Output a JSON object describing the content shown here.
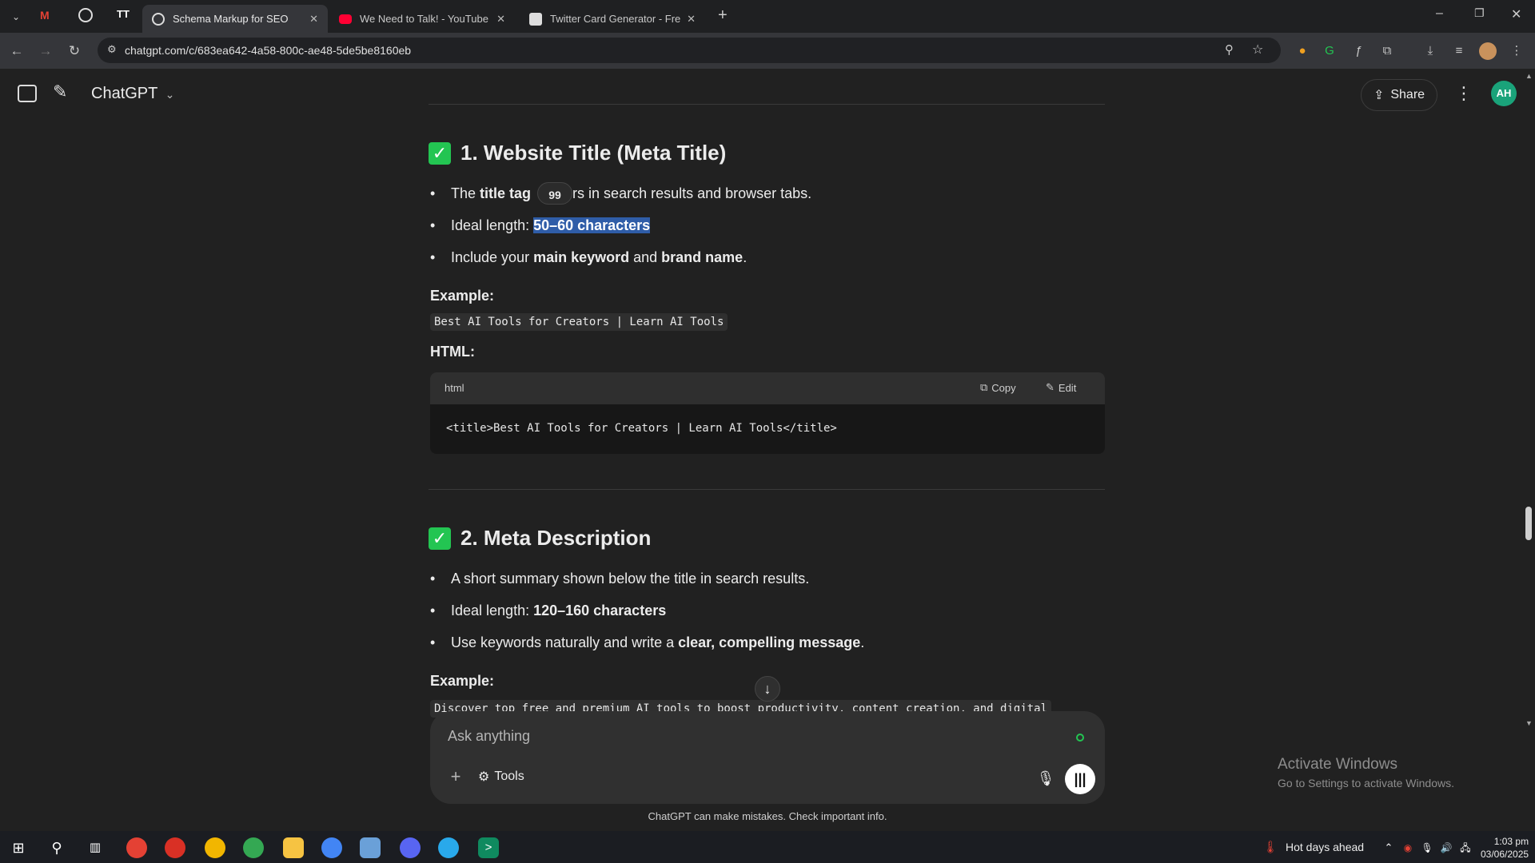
{
  "browser": {
    "tabs": [
      {
        "label": "Schema Markup for SEO",
        "favicon": "chatgpt-icon",
        "active": true
      },
      {
        "label": "We Need to Talk! - YouTube",
        "favicon": "youtube-icon",
        "active": false
      },
      {
        "label": "Twitter Card Generator - Free T",
        "favicon": "generic-page-icon",
        "active": false
      }
    ],
    "url": "chatgpt.com/c/683ea642-4a58-800c-ae48-5de5be8160eb"
  },
  "app": {
    "title": "ChatGPT",
    "share_label": "Share",
    "avatar_initials": "AH",
    "accent": "#23c552"
  },
  "section1": {
    "heading": "1. Website Title (Meta Title)",
    "bullet1": {
      "pre": "The ",
      "bold": "title tag",
      "post": "rs in search results and browser tabs."
    },
    "bullet2": {
      "pre": "Ideal length: ",
      "bold": "50–60 characters"
    },
    "bullet3": {
      "pre": "Include your ",
      "bold1": "main keyword",
      "mid": " and ",
      "bold2": "brand name",
      "post": "."
    },
    "example_label": "Example:",
    "example_code": "Best AI Tools for Creators | Learn AI Tools",
    "html_label": "HTML:",
    "code_lang": "html",
    "copy_label": "Copy",
    "edit_label": "Edit",
    "code_line": "<title>Best AI Tools for Creators | Learn AI Tools</title>",
    "quote_glyph": "99"
  },
  "section2": {
    "heading": "2. Meta Description",
    "bullet1": "A short summary shown below the title in search results.",
    "bullet2": {
      "pre": "Ideal length: ",
      "bold": "120–160 characters"
    },
    "bullet3": {
      "pre": "Use keywords naturally and write a ",
      "bold": "clear, compelling message",
      "post": "."
    },
    "example_label": "Example:",
    "example_code": "Discover top free and premium AI tools to boost productivity, content creation, and digital"
  },
  "composer": {
    "placeholder": "Ask anything",
    "tools_label": "Tools"
  },
  "disclaimer": "ChatGPT can make mistakes. Check important info.",
  "watermark": {
    "line1": "Activate Windows",
    "line2": "Go to Settings to activate Windows."
  },
  "taskbar": {
    "weather": "Hot days ahead",
    "time": "1:03 pm",
    "date": "03/06/2025"
  }
}
